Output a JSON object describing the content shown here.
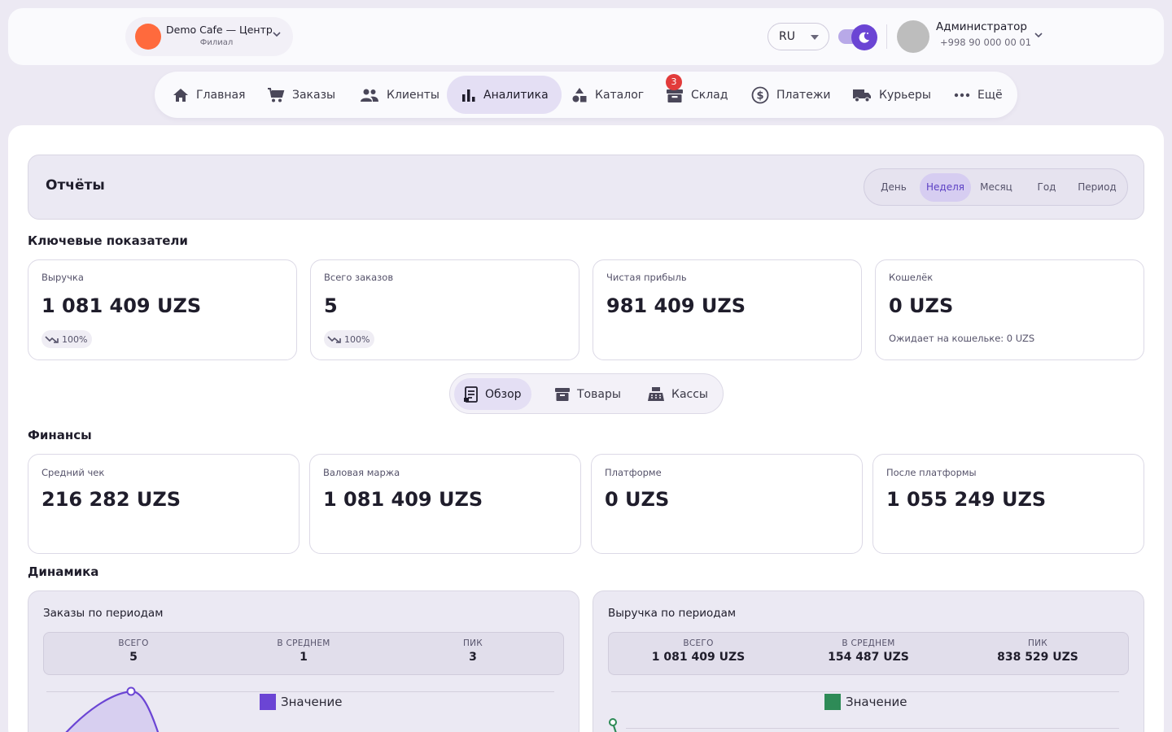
{
  "header": {
    "branch_name": "Demo Cafe — Центр",
    "branch_sub": "Филиал",
    "language": "RU",
    "theme_toggle": "dark",
    "user_name": "Администратор",
    "user_phone": "+998 90 000 00 01"
  },
  "nav": {
    "items": [
      {
        "label": "Главная",
        "icon": "home-icon"
      },
      {
        "label": "Заказы",
        "icon": "cart-icon"
      },
      {
        "label": "Клиенты",
        "icon": "users-icon"
      },
      {
        "label": "Аналитика",
        "icon": "bar-chart-icon",
        "active": true
      },
      {
        "label": "Каталог",
        "icon": "shapes-icon"
      },
      {
        "label": "Склад",
        "icon": "archive-icon",
        "badge": "3"
      },
      {
        "label": "Платежи",
        "icon": "dollar-icon"
      },
      {
        "label": "Курьеры",
        "icon": "truck-icon"
      },
      {
        "label": "Ещё",
        "icon": "more-icon"
      }
    ]
  },
  "reports": {
    "title": "Отчёты",
    "periods": [
      "День",
      "Неделя",
      "Месяц",
      "Год",
      "Период"
    ],
    "active_period": "Неделя"
  },
  "kpi": {
    "title": "Ключевые показатели",
    "cards": [
      {
        "label": "Выручка",
        "value": "1 081 409 UZS",
        "delta": "100%"
      },
      {
        "label": "Всего заказов",
        "value": "5",
        "delta": "100%"
      },
      {
        "label": "Чистая прибыль",
        "value": "981 409 UZS"
      },
      {
        "label": "Кошелёк",
        "value": "0 UZS",
        "note": "Ожидает на кошельке: 0 UZS"
      }
    ]
  },
  "subtabs": {
    "items": [
      "Обзор",
      "Товары",
      "Кассы"
    ],
    "active": "Обзор"
  },
  "finance": {
    "title": "Финансы",
    "cards": [
      {
        "label": "Средний чек",
        "value": "216 282 UZS"
      },
      {
        "label": "Валовая маржа",
        "value": "1 081 409 UZS"
      },
      {
        "label": "Платформе",
        "value": "0 UZS"
      },
      {
        "label": "После платформы",
        "value": "1 055 249 UZS"
      }
    ]
  },
  "dynamics": {
    "title": "Динамика",
    "orders": {
      "title": "Заказы по периодам",
      "stats": [
        {
          "label": "ВСЕГО",
          "value": "5"
        },
        {
          "label": "В СРЕДНЕМ",
          "value": "1"
        },
        {
          "label": "ПИК",
          "value": "3"
        }
      ],
      "legend": "Значение",
      "color": "#6b45d4"
    },
    "revenue": {
      "title": "Выручка по периодам",
      "stats": [
        {
          "label": "ВСЕГО",
          "value": "1 081 409 UZS"
        },
        {
          "label": "В СРЕДНЕМ",
          "value": "154 487 UZS"
        },
        {
          "label": "ПИК",
          "value": "838 529 UZS"
        }
      ],
      "legend": "Значение",
      "color": "#2e8b57"
    }
  },
  "colors": {
    "accent": "#6b45d4",
    "brand_avatar": "#ff6a3d",
    "badge": "#e23b3b"
  }
}
